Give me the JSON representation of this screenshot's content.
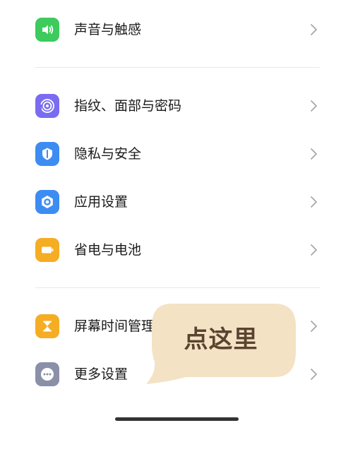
{
  "settings": {
    "items": [
      {
        "label": "声音与触感",
        "icon": "speaker-icon",
        "color": "#3ccb5c"
      },
      {
        "label": "指纹、面部与密码",
        "icon": "fingerprint-icon",
        "color": "#7a6cf0"
      },
      {
        "label": "隐私与安全",
        "icon": "shield-icon",
        "color": "#3d8cf2"
      },
      {
        "label": "应用设置",
        "icon": "app-settings-icon",
        "color": "#3d8cf2"
      },
      {
        "label": "省电与电池",
        "icon": "battery-icon",
        "color": "#f5ad24"
      },
      {
        "label": "屏幕时间管理",
        "icon": "hourglass-icon",
        "color": "#f5ad24"
      },
      {
        "label": "更多设置",
        "icon": "more-icon",
        "color": "#8a90a8"
      }
    ]
  },
  "callout": {
    "text": "点这里",
    "color": "#f3e2c4"
  }
}
